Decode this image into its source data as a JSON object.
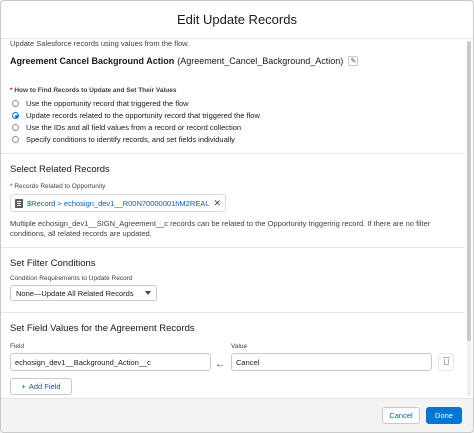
{
  "modal": {
    "title": "Edit Update Records"
  },
  "description": "Update Salesforce records using values from the flow.",
  "element": {
    "label": "Agreement Cancel Background Action",
    "api_name": "(Agreement_Cancel_Background_Action)"
  },
  "how_to_find": {
    "label": "How to Find Records to Update and Set Their Values",
    "options": [
      "Use the opportunity record that triggered the flow",
      "Update records related to the opportunity record that triggered the flow",
      "Use the IDs and all field values from a record or record collection",
      "Specify conditions to identify records, and set fields individually"
    ],
    "selected_index": 1
  },
  "related": {
    "title": "Select Related Records",
    "label": "Records Related to Opportunity",
    "value": "$Record > echosign_dev1__R00N70000001hM2REAU__r",
    "help": "Multiple echosign_dev1__SIGN_Agreement__c records can be related to the Opportunity triggering record. If there are no filter conditions, all related records are updated."
  },
  "filter": {
    "title": "Set Filter Conditions",
    "label": "Condition Requirements to Update Record",
    "value": "None—Update All Related Records"
  },
  "field_values": {
    "title": "Set Field Values for the Agreement Records",
    "field_label": "Field",
    "value_label": "Value",
    "field": "echosign_dev1__Background_Action__c",
    "value": "Cancel",
    "add_label": "Add Field"
  },
  "footer": {
    "cancel": "Cancel",
    "done": "Done"
  },
  "colors": {
    "brand": "#0176d3",
    "required": "#ba0517"
  },
  "icons": [
    "pencil-icon",
    "records-icon",
    "close-icon",
    "chevron-down-icon",
    "left-arrow-icon",
    "trash-icon",
    "plus-icon"
  ]
}
